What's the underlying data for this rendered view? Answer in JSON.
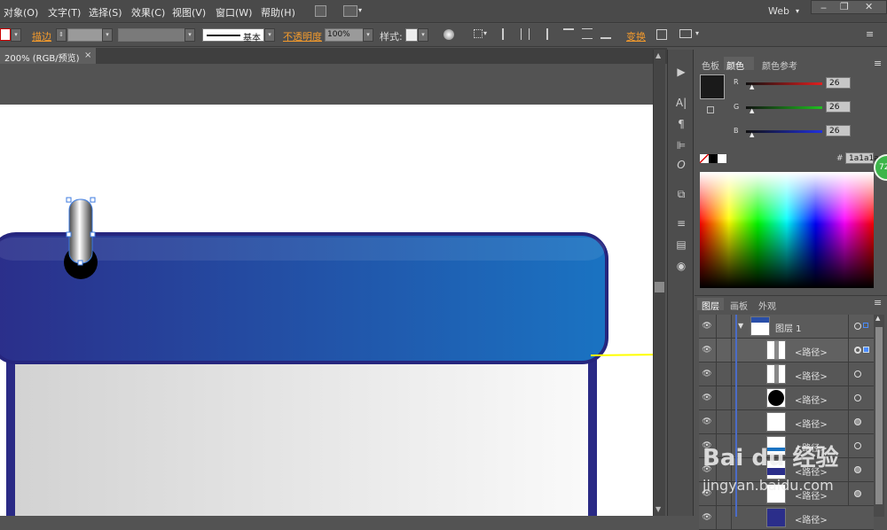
{
  "menu": [
    "对象(O)",
    "文字(T)",
    "选择(S)",
    "效果(C)",
    "视图(V)",
    "窗口(W)",
    "帮助(H)"
  ],
  "workspace": "Web",
  "control": {
    "stroke_label": "描边",
    "brush_label": "基本",
    "opacity_label": "不透明度",
    "opacity_value": "100%",
    "style_label": "样式:",
    "transform_label": "变换"
  },
  "document_tab": "200% (RGB/预览)",
  "color_panel": {
    "tabs": [
      "色板",
      "颜色",
      "颜色参考"
    ],
    "channels": [
      {
        "label": "R",
        "value": "26",
        "color": "#e02020"
      },
      {
        "label": "G",
        "value": "26",
        "color": "#20c020"
      },
      {
        "label": "B",
        "value": "26",
        "color": "#2030e0"
      }
    ],
    "hex_label": "#",
    "hex_value": "1a1a1a"
  },
  "layers_panel": {
    "tabs": [
      "图层",
      "画板",
      "外观"
    ],
    "layer_name": "图层 1",
    "paths": [
      "<路径>",
      "<路径>",
      "<路径>",
      "<路径>",
      "<路径>",
      "<路径>",
      "<路径>",
      "<路径>"
    ]
  },
  "badge_value": "72",
  "watermark": {
    "brand": "Bai du 经验",
    "url": "jingyan.baidu.com"
  },
  "colors": {
    "band_dark": "#2b2e8a",
    "band_light": "#1a73c2",
    "arrow": "#ffff00"
  }
}
